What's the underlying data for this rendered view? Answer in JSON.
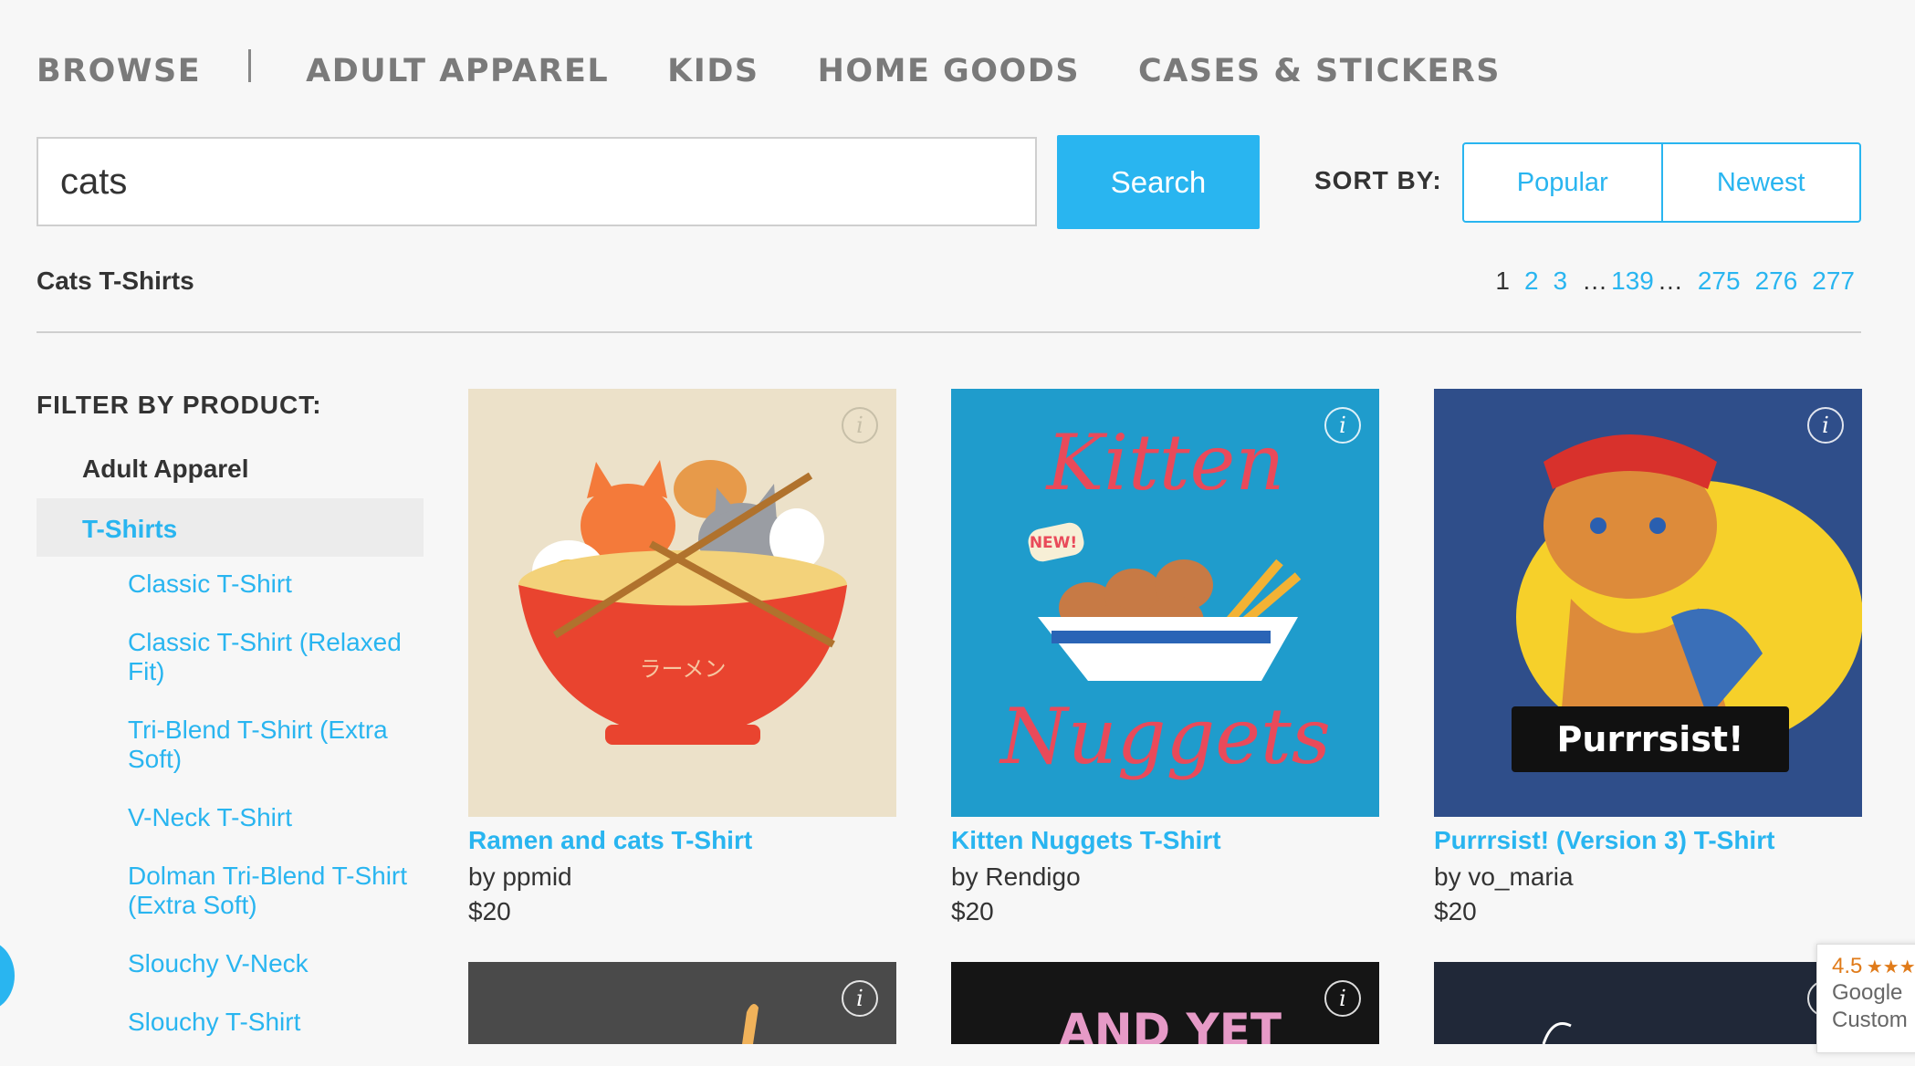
{
  "nav": {
    "browse": "BROWSE",
    "items": [
      "ADULT APPAREL",
      "KIDS",
      "HOME GOODS",
      "CASES & STICKERS"
    ]
  },
  "search": {
    "value": "cats",
    "button": "Search"
  },
  "sort": {
    "label": "SORT BY:",
    "options": [
      "Popular",
      "Newest"
    ]
  },
  "results": {
    "title": "Cats T-Shirts"
  },
  "pagination": {
    "current": "1",
    "pages": [
      "2",
      "3"
    ],
    "middle": "139",
    "last": [
      "275",
      "276",
      "277"
    ],
    "dots": "…"
  },
  "filter": {
    "heading": "FILTER BY PRODUCT:",
    "category": "Adult Apparel",
    "active": "T-Shirts",
    "subitems": [
      "Classic T-Shirt",
      "Classic T-Shirt (Relaxed Fit)",
      "Tri-Blend T-Shirt (Extra Soft)",
      "V-Neck T-Shirt",
      "Dolman Tri-Blend T-Shirt (Extra Soft)",
      "Slouchy V-Neck",
      "Slouchy T-Shirt"
    ]
  },
  "products": [
    {
      "title": "Ramen and cats T-Shirt",
      "artist": "by ppmid",
      "price": "$20",
      "art_text": "ラーメン",
      "bg": "#ece1c9"
    },
    {
      "title": "Kitten Nuggets T-Shirt",
      "artist": "by Rendigo",
      "price": "$20",
      "art_text": "Kitten",
      "art_text2": "Nuggets",
      "art_badge": "NEW!",
      "bg": "#1f9ccc"
    },
    {
      "title": "Purrrsist! (Version 3) T-Shirt",
      "artist": "by vo_maria",
      "price": "$20",
      "art_text": "Purrrsist!",
      "bg": "#2f4e8a"
    }
  ],
  "row2": [
    {
      "bg": "#4a4a4a"
    },
    {
      "bg": "#151515",
      "art_text": "AND YET"
    },
    {
      "bg": "#202838"
    }
  ],
  "info_icon": "i",
  "rating": {
    "score": "4.5",
    "stars": "★★★",
    "line1": "Google",
    "line2": "Custom"
  }
}
